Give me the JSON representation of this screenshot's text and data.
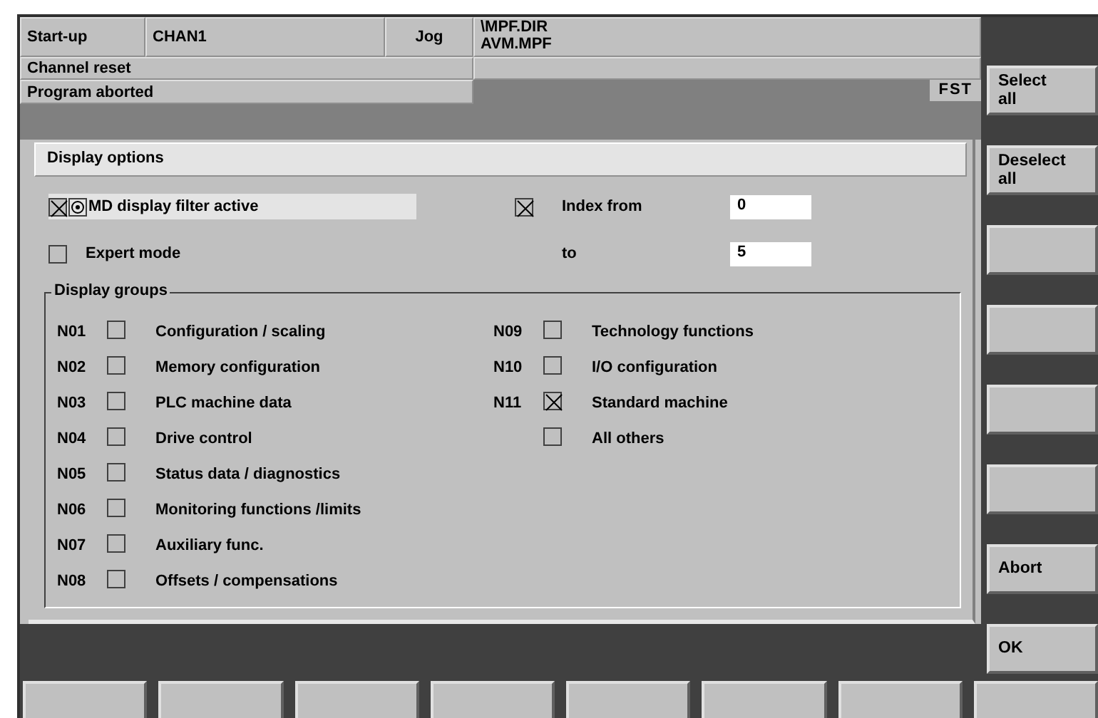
{
  "header": {
    "mode": "Start-up",
    "channel": "CHAN1",
    "operating_mode": "Jog",
    "program_path": [
      "\\MPF.DIR",
      "AVM.MPF"
    ]
  },
  "status": {
    "channel_status": "Channel reset",
    "program_status": "Program aborted",
    "indicator": "FST"
  },
  "dialog": {
    "title": "Display options",
    "md_filter": {
      "label": "MD display filter active",
      "checked": true,
      "focused": true
    },
    "expert_mode": {
      "label": "Expert mode",
      "checked": false
    },
    "index_from": {
      "label": "Index from",
      "checked": true,
      "value": "0"
    },
    "index_to": {
      "label": "to",
      "value": "5"
    },
    "groups": {
      "title": "Display groups",
      "columns": [
        [
          {
            "code": "N01",
            "label": "Configuration / scaling",
            "checked": false
          },
          {
            "code": "N02",
            "label": "Memory configuration",
            "checked": false
          },
          {
            "code": "N03",
            "label": "PLC machine data",
            "checked": false
          },
          {
            "code": "N04",
            "label": "Drive control",
            "checked": false
          },
          {
            "code": "N05",
            "label": "Status data / diagnostics",
            "checked": false
          },
          {
            "code": "N06",
            "label": "Monitoring functions /limits",
            "checked": false
          },
          {
            "code": "N07",
            "label": "Auxiliary func.",
            "checked": false
          },
          {
            "code": "N08",
            "label": "Offsets / compensations",
            "checked": false
          }
        ],
        [
          {
            "code": "N09",
            "label": "Technology functions",
            "checked": false
          },
          {
            "code": "N10",
            "label": "I/O configuration",
            "checked": false
          },
          {
            "code": "N11",
            "label": "Standard machine",
            "checked": true
          },
          {
            "label": "All others",
            "checked": false
          }
        ]
      ]
    }
  },
  "vertical_softkeys": [
    {
      "kind": "labeled",
      "lines": [
        "Select",
        "all"
      ]
    },
    {
      "kind": "labeled",
      "lines": [
        "Deselect",
        "all"
      ]
    },
    {
      "kind": "blank"
    },
    {
      "kind": "blank"
    },
    {
      "kind": "blank"
    },
    {
      "kind": "blank"
    },
    {
      "kind": "labeled",
      "lines": [
        "Abort"
      ]
    },
    {
      "kind": "labeled",
      "lines": [
        "OK"
      ]
    }
  ],
  "horizontal_softkeys": [
    {
      "kind": "blank"
    },
    {
      "kind": "blank"
    },
    {
      "kind": "blank"
    },
    {
      "kind": "blank"
    },
    {
      "kind": "blank"
    },
    {
      "kind": "blank"
    },
    {
      "kind": "blank"
    },
    {
      "kind": "blank"
    }
  ]
}
